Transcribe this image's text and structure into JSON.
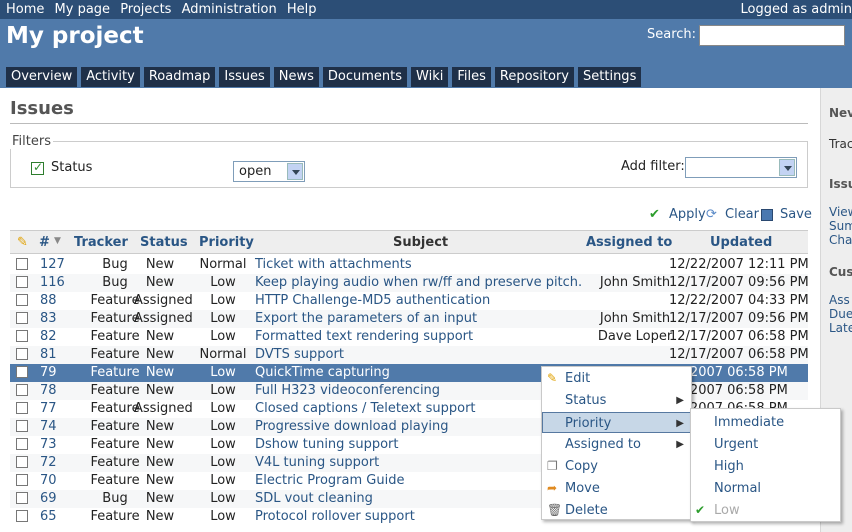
{
  "topmenu": {
    "items": [
      "Home",
      "My page",
      "Projects",
      "Administration",
      "Help"
    ],
    "logged": "Logged as admin"
  },
  "header": {
    "title": "My project",
    "search_label": "Search:"
  },
  "tabs": [
    "Overview",
    "Activity",
    "Roadmap",
    "Issues",
    "News",
    "Documents",
    "Wiki",
    "Files",
    "Repository",
    "Settings"
  ],
  "page": {
    "title": "Issues"
  },
  "filters": {
    "legend": "Filters",
    "status_label": "Status",
    "status_value": "open",
    "add_filter_label": "Add filter:"
  },
  "actions": {
    "apply": "Apply",
    "clear": "Clear",
    "save": "Save"
  },
  "table": {
    "headers": {
      "id": "#",
      "tracker": "Tracker",
      "status": "Status",
      "priority": "Priority",
      "subject": "Subject",
      "assigned": "Assigned to",
      "updated": "Updated"
    },
    "rows": [
      {
        "id": "127",
        "tracker": "Bug",
        "status": "New",
        "priority": "Normal",
        "subject": "Ticket with attachments",
        "assigned": "",
        "updated": "12/22/2007 12:11 PM"
      },
      {
        "id": "116",
        "tracker": "Bug",
        "status": "New",
        "priority": "Low",
        "subject": "Keep playing audio when rw/ff and preserve pitch.",
        "assigned": "John Smith",
        "updated": "12/17/2007 09:56 PM"
      },
      {
        "id": "88",
        "tracker": "Feature",
        "status": "Assigned",
        "priority": "Low",
        "subject": "HTTP Challenge-MD5 authentication",
        "assigned": "",
        "updated": "12/22/2007 04:33 PM"
      },
      {
        "id": "83",
        "tracker": "Feature",
        "status": "Assigned",
        "priority": "Low",
        "subject": "Export the parameters of an input",
        "assigned": "John Smith",
        "updated": "12/17/2007 09:56 PM"
      },
      {
        "id": "82",
        "tracker": "Feature",
        "status": "New",
        "priority": "Low",
        "subject": "Formatted text rendering support",
        "assigned": "Dave Loper",
        "updated": "12/17/2007 06:58 PM"
      },
      {
        "id": "81",
        "tracker": "Feature",
        "status": "New",
        "priority": "Normal",
        "subject": "DVTS support",
        "assigned": "",
        "updated": "12/17/2007 06:58 PM"
      },
      {
        "id": "79",
        "tracker": "Feature",
        "status": "New",
        "priority": "Low",
        "subject": "QuickTime capturing",
        "assigned": "",
        "updated": "17/2007 06:58 PM"
      },
      {
        "id": "78",
        "tracker": "Feature",
        "status": "New",
        "priority": "Low",
        "subject": "Full H323 videoconferencing",
        "assigned": "",
        "updated": "17/2007 06:58 PM"
      },
      {
        "id": "77",
        "tracker": "Feature",
        "status": "Assigned",
        "priority": "Low",
        "subject": "Closed captions / Teletext support",
        "assigned": "",
        "updated": "17/2007 06:58 PM"
      },
      {
        "id": "74",
        "tracker": "Feature",
        "status": "New",
        "priority": "Low",
        "subject": "Progressive download playing",
        "assigned": "",
        "updated": ""
      },
      {
        "id": "73",
        "tracker": "Feature",
        "status": "New",
        "priority": "Low",
        "subject": "Dshow tuning support",
        "assigned": "",
        "updated": ""
      },
      {
        "id": "72",
        "tracker": "Feature",
        "status": "New",
        "priority": "Low",
        "subject": "V4L tuning support",
        "assigned": "",
        "updated": ""
      },
      {
        "id": "70",
        "tracker": "Feature",
        "status": "New",
        "priority": "Low",
        "subject": "Electric Program Guide",
        "assigned": "",
        "updated": ""
      },
      {
        "id": "69",
        "tracker": "Bug",
        "status": "New",
        "priority": "Low",
        "subject": "SDL vout cleaning",
        "assigned": "",
        "updated": ""
      },
      {
        "id": "65",
        "tracker": "Feature",
        "status": "New",
        "priority": "Low",
        "subject": "Protocol rollover support",
        "assigned": "",
        "updated": ""
      }
    ]
  },
  "context_menu": {
    "items": [
      "Edit",
      "Status",
      "Priority",
      "Assigned to",
      "Copy",
      "Move",
      "Delete"
    ]
  },
  "priority_submenu": {
    "items": [
      "Immediate",
      "Urgent",
      "High",
      "Normal",
      "Low"
    ]
  },
  "sidebar": {
    "h1": "Nev",
    "l1": "Trac",
    "h2": "Issu",
    "links": [
      "View",
      "Sum",
      "Cha"
    ],
    "h3": "Cus",
    "links2": [
      "Ass",
      "Due",
      "Late"
    ]
  }
}
